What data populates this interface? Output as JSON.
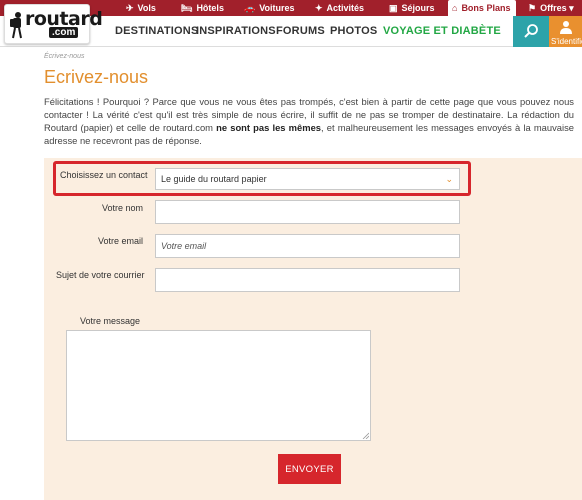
{
  "topbar": {
    "items": [
      {
        "label": "Vols",
        "icon": "plane-icon"
      },
      {
        "label": "Hôtels",
        "icon": "hotel-bed-icon"
      },
      {
        "label": "Voitures",
        "icon": "car-icon"
      },
      {
        "label": "Activités",
        "icon": "activity-icon"
      },
      {
        "label": "Séjours",
        "icon": "suitcase-icon"
      },
      {
        "label": "Bons Plans",
        "icon": "tag-icon"
      },
      {
        "label": "Offres",
        "icon": "offers-icon"
      }
    ]
  },
  "logo": {
    "brand": "routard",
    "suffix": ".com"
  },
  "nav": {
    "items": [
      "DESTINATIONS",
      "INSPIRATIONS",
      "FORUMS",
      "PHOTOS",
      "VOYAGE ET DIABÈTE"
    ],
    "login_label": "S'identifier"
  },
  "page": {
    "breadcrumb": "Écrivez-nous",
    "title": "Ecrivez-nous",
    "intro_1": "Félicitations ! Pourquoi ? Parce que vous ne vous êtes pas trompés, c'est bien à partir de cette page que vous pouvez nous contacter ! La vérité c'est qu'il est très simple de nous écrire, il suffit de ne pas se tromper de destinataire. La rédaction du Routard (papier) et celle de routard.com ",
    "intro_bold": "ne sont pas les mêmes",
    "intro_2": ", et malheureusement les messages envoyés à la mauvaise adresse ne recevront pas de réponse."
  },
  "form": {
    "contact_label": "Choisissez un contact",
    "contact_value": "Le guide du routard papier",
    "name_label": "Votre nom",
    "name_value": "",
    "email_label": "Votre email",
    "email_placeholder": "Votre email",
    "subject_label": "Sujet de votre courrier",
    "subject_value": "",
    "message_label": "Votre message",
    "submit_label": "ENVOYER"
  },
  "colors": {
    "topbar": "#a1202b",
    "accent_orange": "#e28f2e",
    "accent_teal": "#2da3a9",
    "accent_green": "#22a744",
    "highlight_red": "#d6262c",
    "form_bg": "#fbeee0"
  }
}
